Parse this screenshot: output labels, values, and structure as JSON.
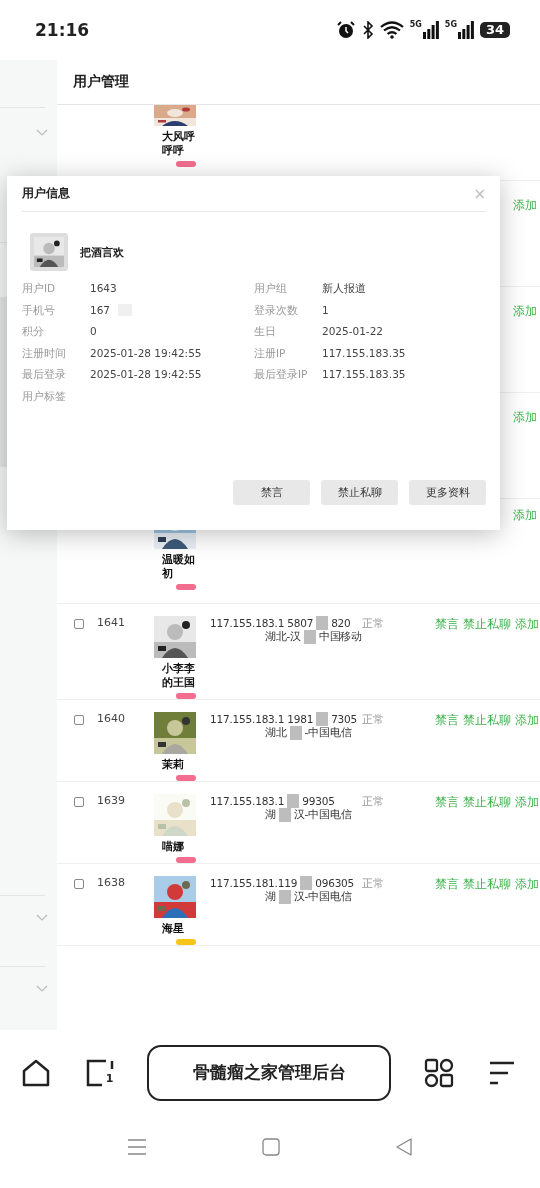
{
  "status_bar": {
    "time": "21:16",
    "signals": [
      "5G",
      "5G"
    ],
    "battery": "34"
  },
  "page": {
    "title": "用户管理"
  },
  "rows": [
    {
      "kind": "top",
      "name": "大风呼呼呼",
      "badge": {
        "color": "#f26d8f"
      }
    },
    {
      "kind": "covered",
      "actions": [
        "添加"
      ]
    },
    {
      "kind": "covered",
      "actions": [
        "添加"
      ]
    },
    {
      "kind": "covered",
      "actions": [
        "添加"
      ]
    },
    {
      "kind": "bottom",
      "name": "温暖如初",
      "badge": {
        "color": "#f26d8f"
      },
      "actions": [
        "添加"
      ]
    },
    {
      "kind": "full",
      "checked": false,
      "id": "1641",
      "name": "小李李的王国",
      "badge": {
        "color": "#f26d8f"
      },
      "ip": "117.155.183.1",
      "phone_before": "5807",
      "phone_after": "820",
      "location_before": "湖北-汉",
      "location_after": "中国移动",
      "status": "正常",
      "actions": [
        "禁言",
        "禁止私聊",
        "添加"
      ]
    },
    {
      "kind": "full",
      "checked": false,
      "id": "1640",
      "name": "茉莉",
      "badge": {
        "color": "#f26d8f"
      },
      "ip": "117.155.183.1",
      "phone_before": "1981",
      "phone_after": "7305",
      "location_before": "湖北",
      "location_after": "-中国电信",
      "status": "正常",
      "actions": [
        "禁言",
        "禁止私聊",
        "添加"
      ]
    },
    {
      "kind": "full",
      "checked": false,
      "id": "1639",
      "name": "喵娜",
      "badge": {
        "color": "#f26d8f"
      },
      "ip": "117.155.183.1",
      "phone_after": "99305",
      "location_before": "湖",
      "location_after": "汉-中国电信",
      "status": "正常",
      "actions": [
        "禁言",
        "禁止私聊",
        "添加"
      ]
    },
    {
      "kind": "full",
      "checked": false,
      "id": "1638",
      "name": "海星",
      "badge": {
        "color": "#f5c518"
      },
      "ip": "117.155.181.119",
      "phone_after": "096305",
      "location_before": "湖",
      "location_after": "汉-中国电信",
      "status": "正常",
      "actions": [
        "禁言",
        "禁止私聊",
        "添加"
      ]
    }
  ],
  "modal": {
    "title": "用户信息",
    "close": "×",
    "name": "把酒言欢",
    "fields": [
      {
        "label": "用户ID",
        "value": "1643"
      },
      {
        "label": "用户组",
        "value": "新人报道"
      },
      {
        "label": "手机号",
        "value": "167",
        "redacted": true
      },
      {
        "label": "登录次数",
        "value": "1"
      },
      {
        "label": "积分",
        "value": "0"
      },
      {
        "label": "生日",
        "value": "2025-01-22"
      },
      {
        "label": "注册时间",
        "value": "2025-01-28 19:42:55"
      },
      {
        "label": "注册IP",
        "value": "117.155.183.35"
      },
      {
        "label": "最后登录",
        "value": "2025-01-28 19:42:55"
      },
      {
        "label": "最后登录IP",
        "value": "117.155.183.35"
      },
      {
        "label": "用户标签"
      }
    ],
    "buttons": [
      "禁言",
      "禁止私聊",
      "更多资料"
    ]
  },
  "browser_bar": {
    "tab_count": "1",
    "title": "骨髓瘤之家管理后台"
  }
}
